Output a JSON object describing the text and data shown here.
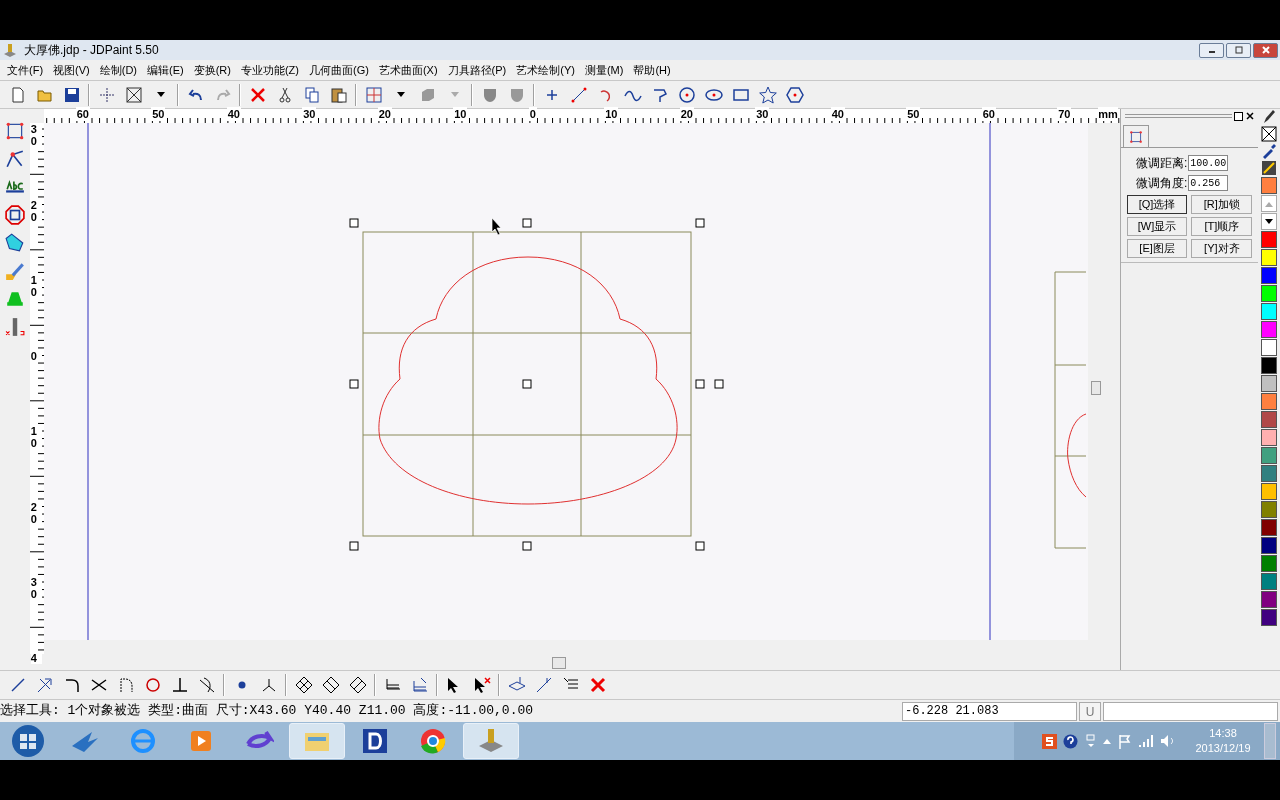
{
  "window": {
    "title": "大厚佛.jdp - JDPaint 5.50"
  },
  "menu": [
    "文件(F)",
    "视图(V)",
    "绘制(D)",
    "编辑(E)",
    "变换(R)",
    "专业功能(Z)",
    "几何曲面(G)",
    "艺术曲面(X)",
    "刀具路径(P)",
    "艺术绘制(Y)",
    "测量(M)",
    "帮助(H)"
  ],
  "ruler": {
    "horizontal": [
      "60",
      "50",
      "40",
      "30",
      "20",
      "10",
      "0",
      "10",
      "20",
      "30",
      "40",
      "50",
      "60",
      "70"
    ],
    "unit": "mm",
    "vertical": [
      "30",
      "20",
      "10",
      "0",
      "10",
      "20",
      "30",
      "4"
    ]
  },
  "panel": {
    "fields": [
      {
        "label": "微调距离:",
        "value": "100.00"
      },
      {
        "label": "微调角度:",
        "value": "0.256"
      }
    ],
    "buttons": [
      "[Q]选择",
      "[R]加锁",
      "[W]显示",
      "[T]顺序",
      "[E]图层",
      "[Y]对齐"
    ]
  },
  "palette": [
    {
      "color": "#ff7f3f"
    },
    {
      "color": "#ff0000"
    },
    {
      "color": "#ffff00"
    },
    {
      "color": "#0000ff"
    },
    {
      "color": "#00ff00"
    },
    {
      "color": "#00ffff"
    },
    {
      "color": "#ff00ff"
    },
    {
      "color": "#ffffff"
    },
    {
      "color": "#000000"
    },
    {
      "color": "#c0c0c0"
    },
    {
      "color": "#ff8040"
    },
    {
      "color": "#b04848"
    },
    {
      "color": "#ffb0b0"
    },
    {
      "color": "#40a080"
    },
    {
      "color": "#308080"
    },
    {
      "color": "#ffc000"
    },
    {
      "color": "#808000"
    },
    {
      "color": "#800000"
    },
    {
      "color": "#000080"
    },
    {
      "color": "#008000"
    },
    {
      "color": "#008080"
    },
    {
      "color": "#800080"
    },
    {
      "color": "#400080"
    }
  ],
  "status_bar": {
    "message": "选择工具: 1个对象被选 类型:曲面 尺寸:X43.60 Y40.40 Z11.00 高度:-11.00,0.00",
    "coordinates": "-6.228 21.083",
    "unit_button": "U"
  },
  "taskbar": {
    "apps": [
      {
        "kind": "bird",
        "open": false
      },
      {
        "kind": "browser",
        "open": false
      },
      {
        "kind": "media",
        "open": false
      },
      {
        "kind": "sync",
        "open": false
      },
      {
        "kind": "folder",
        "open": true
      },
      {
        "kind": "jd",
        "open": false
      },
      {
        "kind": "chrome",
        "open": false
      },
      {
        "kind": "engrave",
        "open": true
      }
    ],
    "time": "14:38",
    "date": "2013/12/19"
  }
}
